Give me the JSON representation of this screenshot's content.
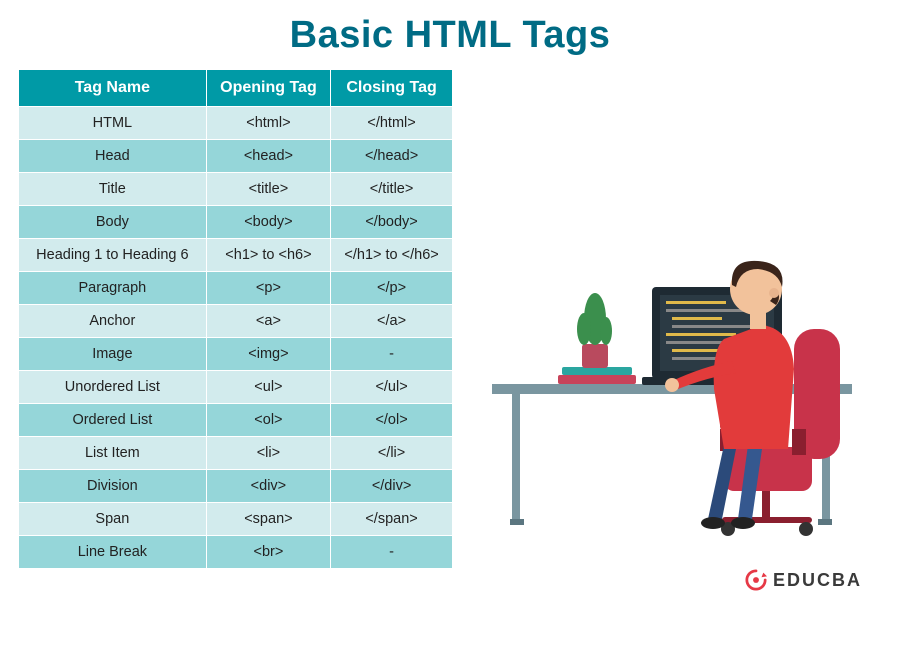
{
  "title": "Basic HTML Tags",
  "table": {
    "headers": [
      "Tag Name",
      "Opening Tag",
      "Closing Tag"
    ],
    "rows": [
      {
        "name": "HTML",
        "open": "<html>",
        "close": "</html>"
      },
      {
        "name": "Head",
        "open": "<head>",
        "close": "</head>"
      },
      {
        "name": "Title",
        "open": "<title>",
        "close": "</title>"
      },
      {
        "name": "Body",
        "open": "<body>",
        "close": "</body>"
      },
      {
        "name": "Heading 1 to Heading 6",
        "open": "<h1> to <h6>",
        "close": "</h1> to </h6>"
      },
      {
        "name": "Paragraph",
        "open": "<p>",
        "close": "</p>"
      },
      {
        "name": "Anchor",
        "open": "<a>",
        "close": "</a>"
      },
      {
        "name": "Image",
        "open": "<img>",
        "close": "-"
      },
      {
        "name": "Unordered List",
        "open": "<ul>",
        "close": "</ul>"
      },
      {
        "name": "Ordered List",
        "open": "<ol>",
        "close": "</ol>"
      },
      {
        "name": "List Item",
        "open": "<li>",
        "close": "</li>"
      },
      {
        "name": "Division",
        "open": "<div>",
        "close": "</div>"
      },
      {
        "name": "Span",
        "open": "<span>",
        "close": "</span>"
      },
      {
        "name": "Line Break",
        "open": "<br>",
        "close": "-"
      }
    ]
  },
  "logo": {
    "text": "EDUCBA"
  },
  "colors": {
    "title": "#006b84",
    "header_bg": "#009aa6",
    "row_light": "#d2ebed",
    "row_dark": "#95d6d9",
    "logo_accent": "#e63946"
  }
}
